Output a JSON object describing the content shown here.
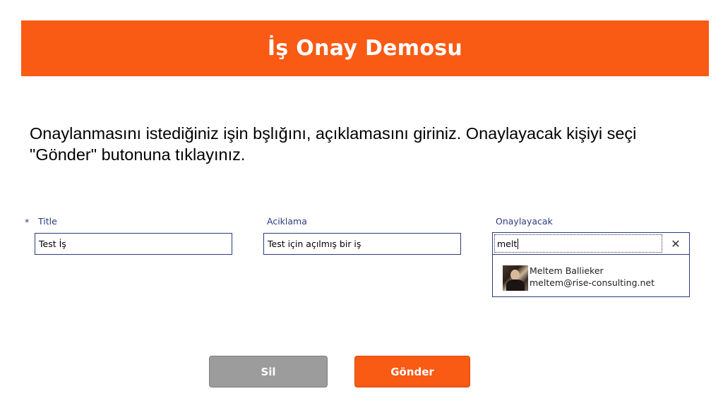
{
  "header": {
    "title": "İş Onay Demosu",
    "background": "#f95a14"
  },
  "instructions": {
    "line1": "Onaylanmasını istediğiniz işin bşlığını, açıklamasını giriniz. Onaylayacak kişiyi seçi",
    "line2": "\"Gönder\" butonuna tıklayınız."
  },
  "form": {
    "title": {
      "required_mark": "*",
      "label": "Title",
      "value": "Test İş"
    },
    "aciklama": {
      "label": "Aciklama",
      "value": "Test için açılmış bir iş"
    },
    "onaylayacak": {
      "label": "Onaylayacak",
      "search_value": "melt",
      "clear_icon": "close-icon",
      "clear_glyph": "✕",
      "suggestions": [
        {
          "name": "Meltem Ballieker",
          "email": "meltem@rise-consulting.net",
          "avatar": "avatar-photo"
        }
      ]
    }
  },
  "buttons": {
    "sil_label": "Sil",
    "gonder_label": "Gönder",
    "sil_color": "#9c9c9c",
    "gonder_color": "#f95a14"
  },
  "colors": {
    "accent": "#f95a14",
    "field_border": "#2c3a7e"
  }
}
